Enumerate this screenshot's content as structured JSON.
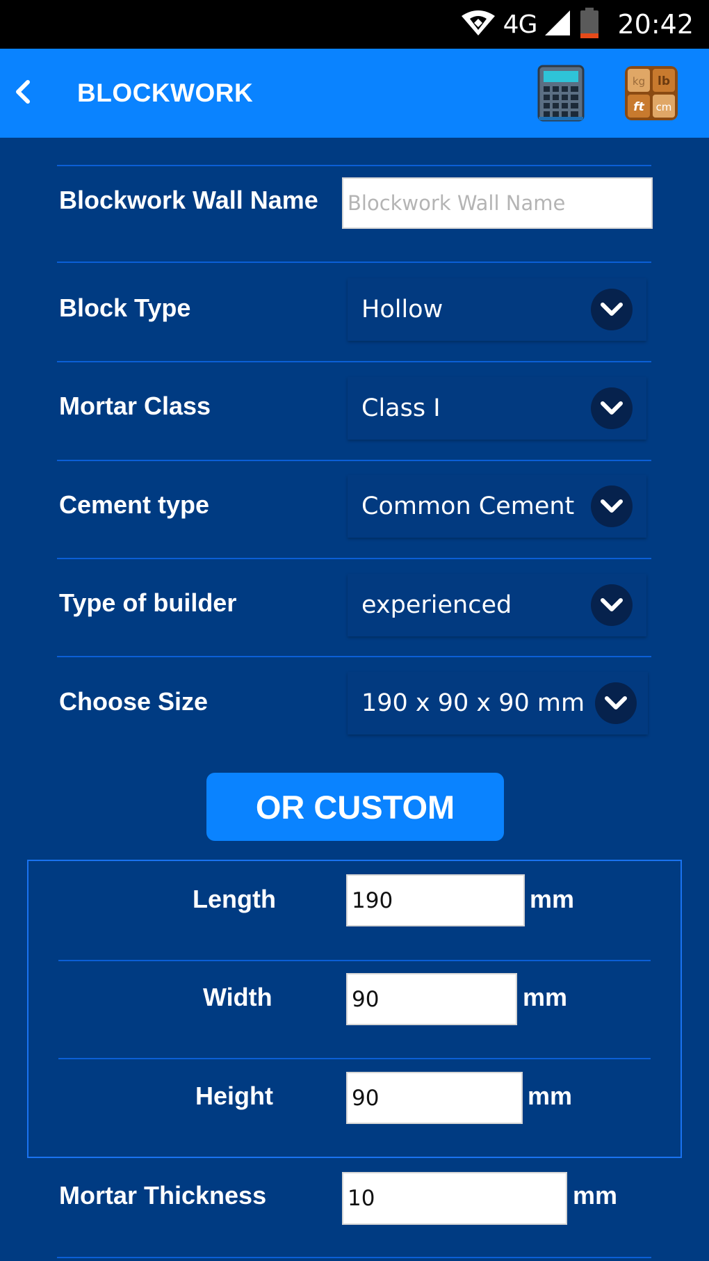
{
  "status_bar": {
    "network": "4G",
    "time": "20:42"
  },
  "app_bar": {
    "title": "BLOCKWORK",
    "icons": [
      "back-icon",
      "calculator-icon",
      "unit-converter-icon"
    ],
    "converter_units": [
      "kg",
      "lb",
      "ft",
      "cm"
    ]
  },
  "form": {
    "wall_name": {
      "label": "Blockwork Wall Name",
      "value": "",
      "placeholder": "Blockwork Wall Name"
    },
    "block_type": {
      "label": "Block Type",
      "value": "Hollow"
    },
    "mortar_class": {
      "label": "Mortar Class",
      "value": "Class I"
    },
    "cement_type": {
      "label": "Cement type",
      "value": "Common Cement"
    },
    "builder_type": {
      "label": "Type of builder",
      "value": "experienced"
    },
    "size": {
      "label": "Choose Size",
      "value": "190 x 90 x 90 mm"
    }
  },
  "custom_button": "OR CUSTOM",
  "custom": {
    "length": {
      "label": "Length",
      "value": "190",
      "unit": "mm"
    },
    "width": {
      "label": "Width",
      "value": "90",
      "unit": "mm"
    },
    "height": {
      "label": "Height",
      "value": "90",
      "unit": "mm"
    }
  },
  "mortar_thickness": {
    "label": "Mortar Thickness",
    "value": "10",
    "unit": "mm"
  },
  "colors": {
    "background": "#003b82",
    "app_bar": "#0a83ff",
    "divider": "#0b5fd6",
    "chevron_circle": "#06224d"
  }
}
